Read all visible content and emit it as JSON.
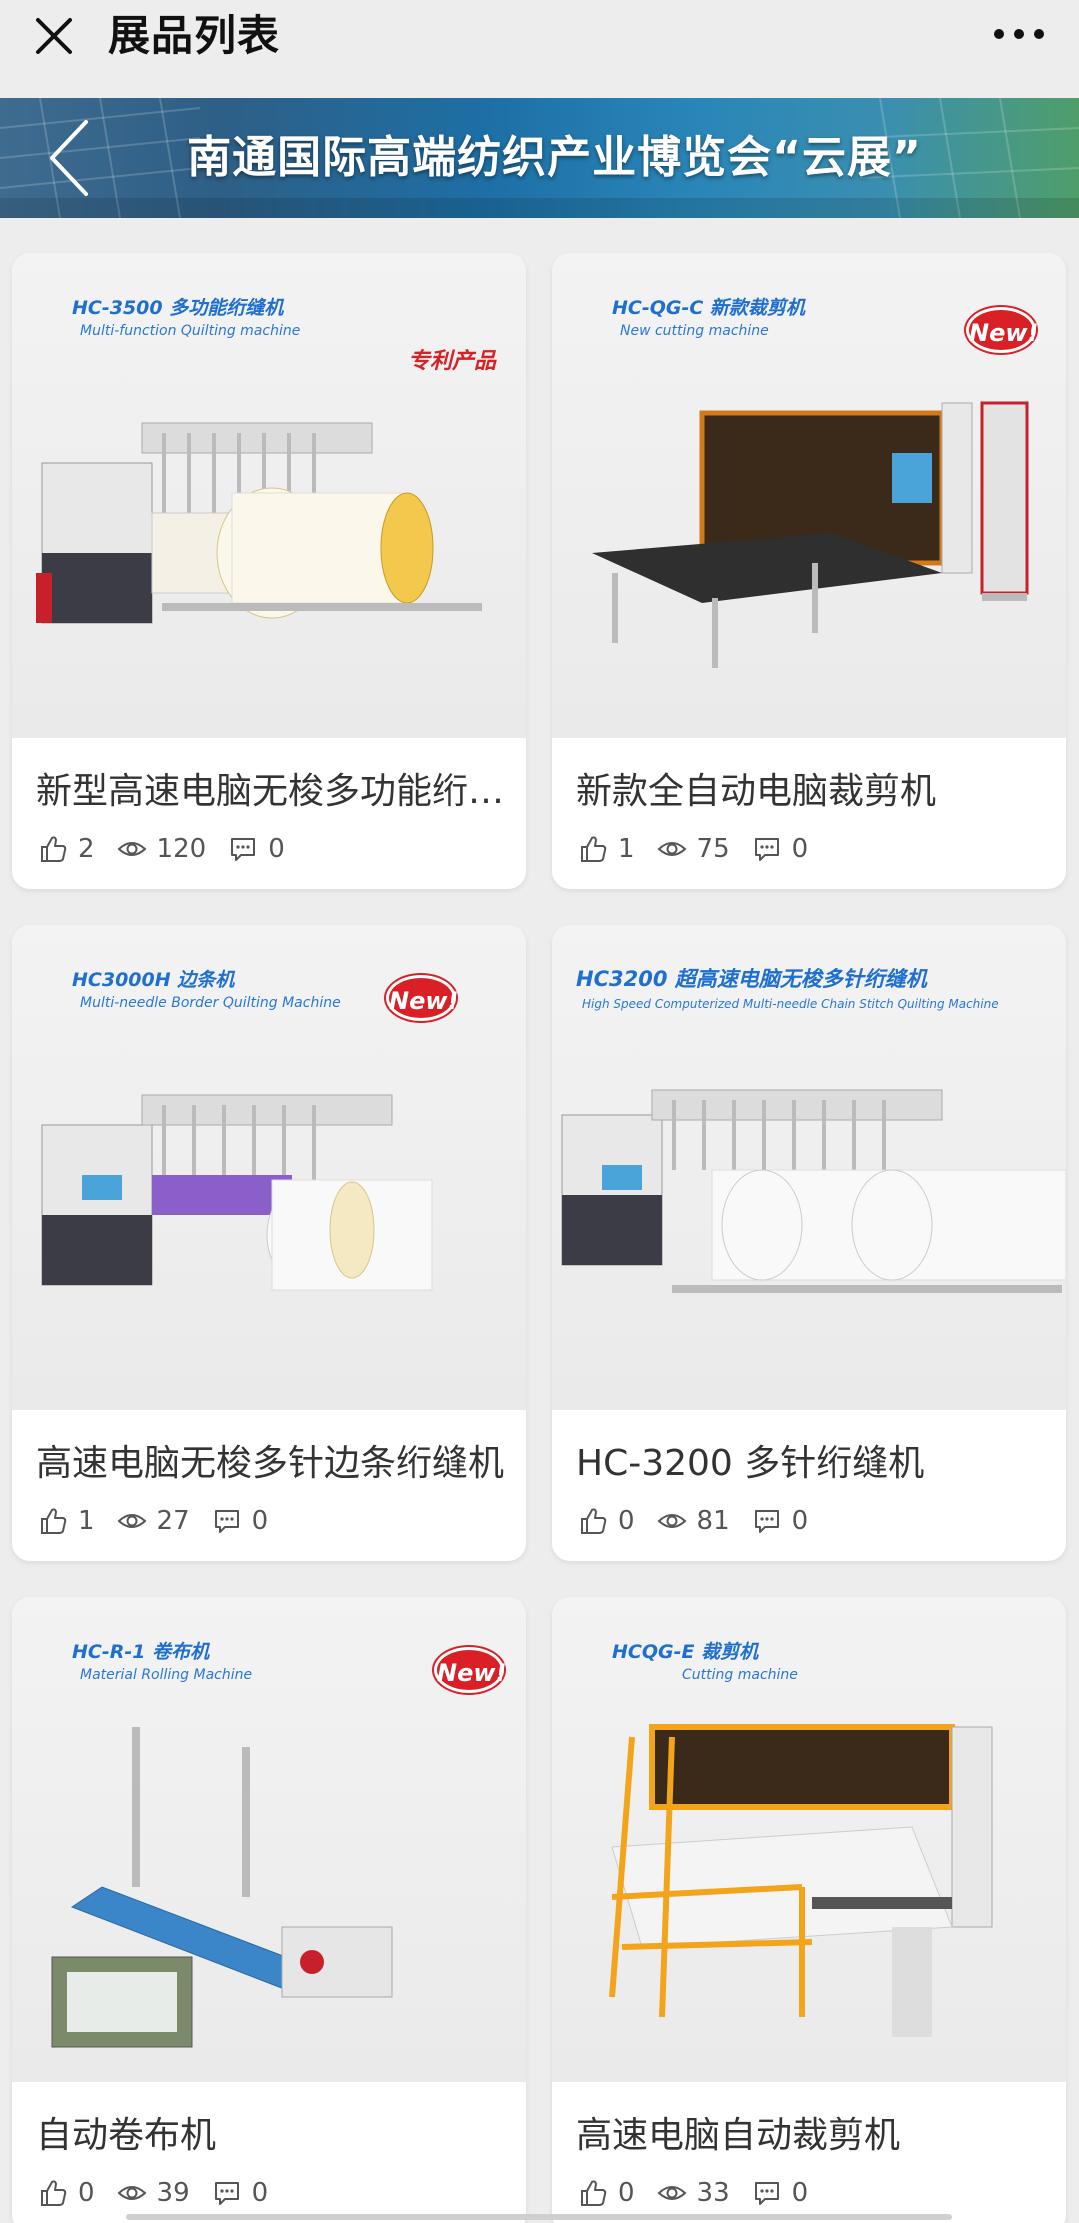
{
  "header": {
    "title": "展品列表"
  },
  "banner": {
    "title": "南通国际高端纺织产业博览会“云展”"
  },
  "cards": [
    {
      "title": "新型高速电脑无梭多功能绗缝机",
      "likes": "2",
      "views": "120",
      "comments": "0",
      "img_model": "HC-3500 多功能绗缝机",
      "img_sub": "Multi-function Quilting machine",
      "badge": "专利产品"
    },
    {
      "title": "新款全自动电脑裁剪机",
      "likes": "1",
      "views": "75",
      "comments": "0",
      "img_model": "HC-QG-C  新款裁剪机",
      "img_sub": "New cutting machine",
      "badge": "New!"
    },
    {
      "title": "高速电脑无梭多针边条绗缝机",
      "likes": "1",
      "views": "27",
      "comments": "0",
      "img_model": "HC3000H  边条机",
      "img_sub": "Multi-needle Border Quilting Machine",
      "badge": "New!"
    },
    {
      "title": "HC-3200 多针绗缝机",
      "likes": "0",
      "views": "81",
      "comments": "0",
      "img_model": "HC3200 超高速电脑无梭多针绗缝机",
      "img_sub": "High Speed Computerized Multi-needle Chain Stitch Quilting Machine",
      "badge": ""
    },
    {
      "title": "自动卷布机",
      "likes": "0",
      "views": "39",
      "comments": "0",
      "img_model": "HC-R-1  卷布机",
      "img_sub": "Material Rolling Machine",
      "badge": "New!"
    },
    {
      "title": "高速电脑自动裁剪机",
      "likes": "0",
      "views": "33",
      "comments": "0",
      "img_model": "HCQG-E  裁剪机",
      "img_sub": "Cutting machine",
      "badge": ""
    }
  ],
  "colors": {
    "accent": "#1f6fd1",
    "badge": "#d92027",
    "machine_orange": "#f2a51a"
  }
}
